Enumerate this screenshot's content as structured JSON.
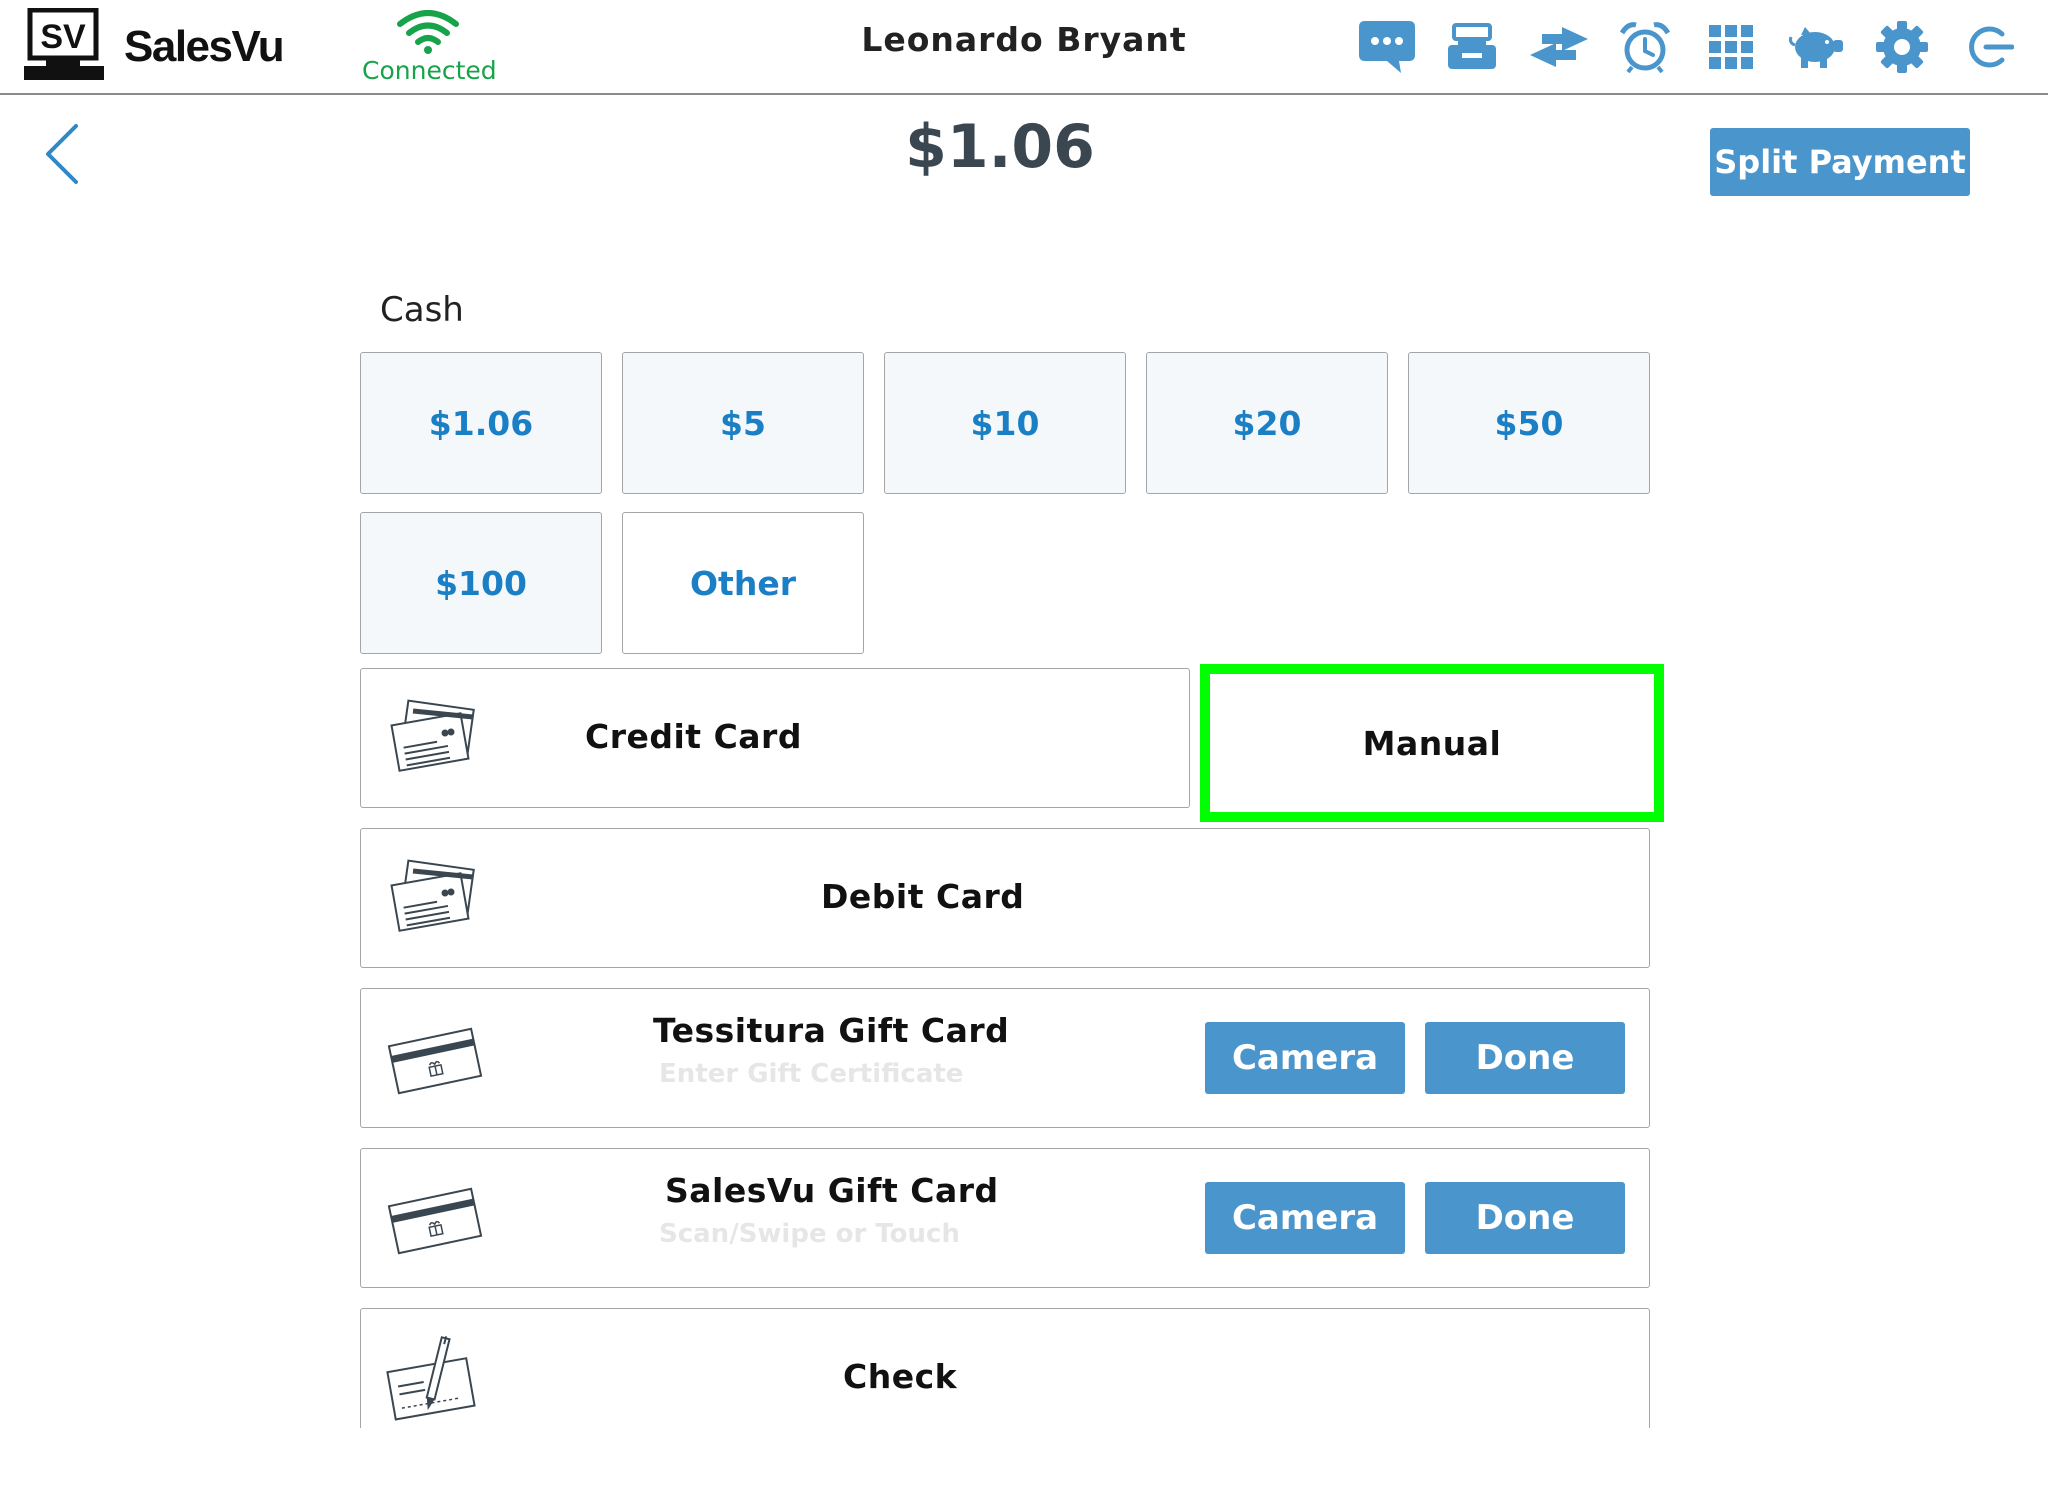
{
  "topbar": {
    "logo_text": "SV",
    "brand": "SalesVu",
    "connection_status": "Connected",
    "user_name": "Leonardo Bryant",
    "icons": [
      "chat-icon",
      "cash-drawer-icon",
      "transfer-icon",
      "alarm-clock-icon",
      "grid-icon",
      "piggy-bank-icon",
      "gear-icon",
      "logout-icon"
    ]
  },
  "header": {
    "total": "$1.06",
    "split_payment_label": "Split Payment"
  },
  "cash": {
    "label": "Cash",
    "options": [
      "$1.06",
      "$5",
      "$10",
      "$20",
      "$50",
      "$100",
      "Other"
    ]
  },
  "payments": {
    "credit_card": {
      "label": "Credit Card",
      "manual_label": "Manual"
    },
    "debit_card": {
      "label": "Debit Card"
    },
    "tessitura_gift_card": {
      "label": "Tessitura Gift Card",
      "placeholder": "Enter Gift Certificate",
      "camera_label": "Camera",
      "done_label": "Done"
    },
    "salesvu_gift_card": {
      "label": "SalesVu Gift Card",
      "placeholder": "Scan/Swipe or Touch",
      "camera_label": "Camera",
      "done_label": "Done"
    },
    "check": {
      "label": "Check"
    }
  },
  "colors": {
    "accent_blue": "#4a96cc",
    "link_blue": "#1b7fc5",
    "connected_green": "#17a34a",
    "highlight_green": "#00ff00"
  }
}
